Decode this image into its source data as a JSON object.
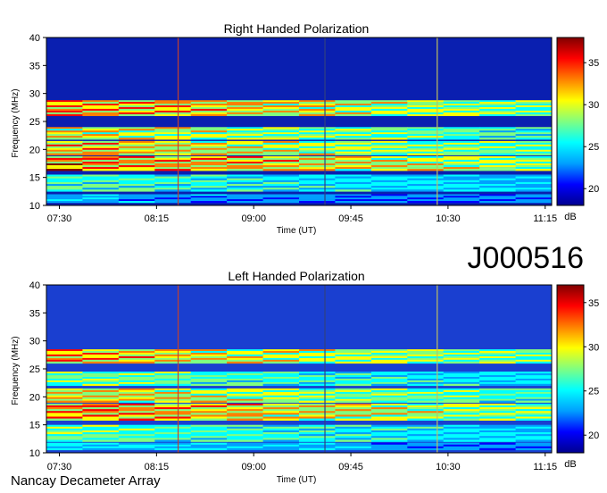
{
  "page": {
    "observation_id": "J000516",
    "instrument": "Nancay Decameter Array"
  },
  "chart_data": [
    {
      "type": "heatmap",
      "title": "Right Handed Polarization",
      "xlabel": "Time (UT)",
      "ylabel": "Frequency (MHz)",
      "x_ticks": [
        "07:30",
        "08:15",
        "09:00",
        "09:45",
        "10:30",
        "11:15"
      ],
      "y_ticks": [
        10,
        15,
        20,
        25,
        30,
        35,
        40
      ],
      "ylim": [
        10,
        40
      ],
      "colorbar": {
        "label": "dB",
        "ticks": [
          20,
          25,
          30,
          35
        ],
        "range": [
          18,
          38
        ]
      },
      "colormap": [
        "#00008f",
        "#0000ff",
        "#00a0ff",
        "#00ffff",
        "#80ff80",
        "#ffff00",
        "#ff8000",
        "#ff0000",
        "#800000"
      ],
      "background_color": "#0a1fb0",
      "bands": [
        {
          "f_low": 26.0,
          "f_high": 28.8,
          "level": 0.92
        },
        {
          "f_low": 21.8,
          "f_high": 24.0,
          "level": 0.78
        },
        {
          "f_low": 19.0,
          "f_high": 21.5,
          "level": 0.85
        },
        {
          "f_low": 16.2,
          "f_high": 18.8,
          "level": 0.96
        },
        {
          "f_low": 12.5,
          "f_high": 15.5,
          "level": 0.55
        },
        {
          "f_low": 10.5,
          "f_high": 12.0,
          "level": 0.35
        }
      ],
      "vertical_lines_time": [
        "08:25",
        "09:33",
        "10:25"
      ]
    },
    {
      "type": "heatmap",
      "title": "Left Handed Polarization",
      "xlabel": "Time (UT)",
      "ylabel": "Frequency (MHz)",
      "x_ticks": [
        "07:30",
        "08:15",
        "09:00",
        "09:45",
        "10:30",
        "11:15"
      ],
      "y_ticks": [
        10,
        15,
        20,
        25,
        30,
        35,
        40
      ],
      "ylim": [
        10,
        40
      ],
      "colorbar": {
        "label": "dB",
        "ticks": [
          20,
          25,
          30,
          35
        ],
        "range": [
          18,
          37
        ]
      },
      "colormap": [
        "#00008f",
        "#0000ff",
        "#00a0ff",
        "#00ffff",
        "#80ff80",
        "#ffff00",
        "#ff8000",
        "#ff0000",
        "#800000"
      ],
      "background_color": "#1a3fd0",
      "bands": [
        {
          "f_low": 26.0,
          "f_high": 28.5,
          "level": 0.88
        },
        {
          "f_low": 22.0,
          "f_high": 24.5,
          "level": 0.62
        },
        {
          "f_low": 19.0,
          "f_high": 21.5,
          "level": 0.8
        },
        {
          "f_low": 15.8,
          "f_high": 18.8,
          "level": 0.93
        },
        {
          "f_low": 12.0,
          "f_high": 15.0,
          "level": 0.6
        },
        {
          "f_low": 10.5,
          "f_high": 11.8,
          "level": 0.4
        }
      ],
      "vertical_lines_time": [
        "08:25",
        "09:33",
        "10:25"
      ]
    }
  ]
}
